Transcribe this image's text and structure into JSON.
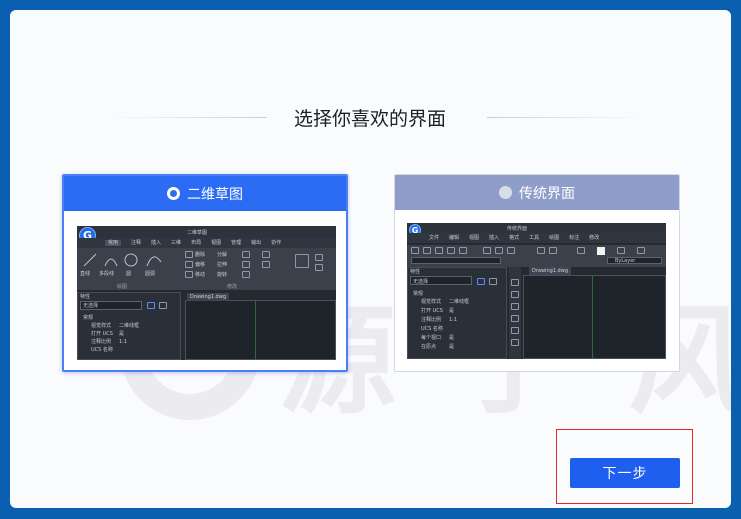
{
  "dialog": {
    "title": "选择你喜欢的界面",
    "next_button": "下一步"
  },
  "options": [
    {
      "label": "二维草图",
      "selected": true,
      "preview": {
        "window_title": "二维草图",
        "menu_tabs": [
          "常用",
          "注释",
          "插入",
          "三维",
          "布局",
          "视图",
          "管理",
          "输出",
          "协作"
        ],
        "ribbon_tools": [
          "直线",
          "多段线",
          "圆",
          "圆弧"
        ],
        "ribbon_tools_2": [
          "删除",
          "分解",
          "偏移",
          "拉伸",
          "移动",
          "旋转"
        ],
        "group_labels": [
          "绘图",
          "修改"
        ],
        "panel_title": "特性",
        "select_box": "无选择",
        "props_header": "常规",
        "props": [
          {
            "k": "视觉样式",
            "v": "二维线框"
          },
          {
            "k": "打开 UCS",
            "v": "是"
          },
          {
            "k": "注释比例",
            "v": "1:1"
          },
          {
            "k": "UCS 名称",
            "v": ""
          }
        ],
        "doc_tab": "Drawing1.dwg"
      }
    },
    {
      "label": "传统界面",
      "selected": false,
      "preview": {
        "window_title": "传统界面",
        "menu_tabs": [
          "文件",
          "编辑",
          "视图",
          "插入",
          "格式",
          "工具",
          "绘图",
          "标注",
          "修改"
        ],
        "layer_label": "ByLayer",
        "panel_title": "特性",
        "select_box": "无选择",
        "props_header": "常规",
        "props": [
          {
            "k": "视觉样式",
            "v": "二维线框"
          },
          {
            "k": "打开 UCS",
            "v": "是"
          },
          {
            "k": "注释比例",
            "v": "1:1"
          },
          {
            "k": "UCS 名称",
            "v": ""
          },
          {
            "k": "每个视口",
            "v": "是"
          },
          {
            "k": "在原点",
            "v": "是"
          }
        ],
        "doc_tab": "Drawing1.dwg"
      }
    }
  ],
  "watermark_text": "源 于 风",
  "colors": {
    "accent": "#1e5ff0",
    "selected_header": "#2c6cf4",
    "unselected_header": "#8f9ec9",
    "highlight_border": "#e2262a",
    "desktop": "#0a5fb0"
  }
}
